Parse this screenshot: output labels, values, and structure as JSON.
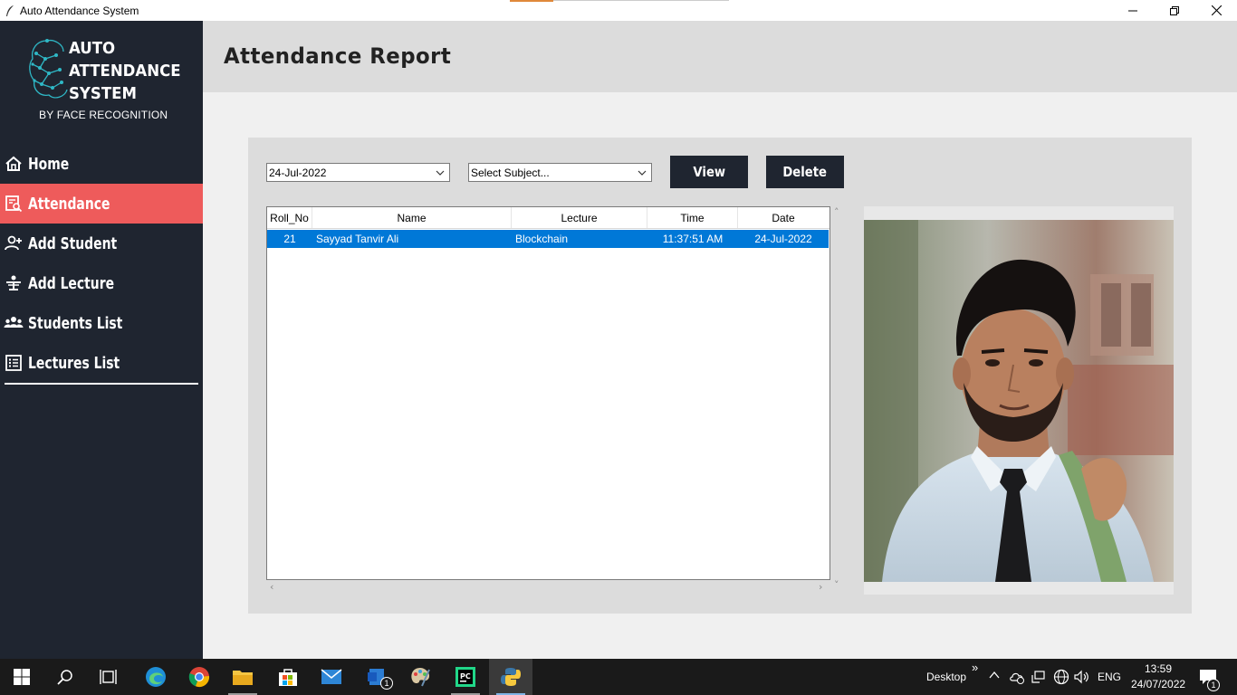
{
  "window": {
    "title": "Auto Attendance System",
    "controls": {
      "minimize": "minimize-icon",
      "maximize": "restore-icon",
      "close": "close-icon"
    }
  },
  "sidebar": {
    "logo": {
      "line1": "AUTO",
      "line2": "ATTENDANCE",
      "line3": "SYSTEM",
      "subtitle": "BY FACE RECOGNITION"
    },
    "items": [
      {
        "label": "Home",
        "icon": "home-icon",
        "active": false
      },
      {
        "label": "Attendance",
        "icon": "report-search-icon",
        "active": true
      },
      {
        "label": "Add Student",
        "icon": "add-user-icon",
        "active": false
      },
      {
        "label": "Add Lecture",
        "icon": "lecture-icon",
        "active": false
      },
      {
        "label": "Students List",
        "icon": "group-icon",
        "active": false
      },
      {
        "label": "Lectures List",
        "icon": "list-icon",
        "active": false
      }
    ],
    "colors": {
      "background": "#1f2530",
      "active": "#ee5b5b"
    }
  },
  "header": {
    "title": "Attendance Report"
  },
  "filters": {
    "date_value": "24-Jul-2022",
    "subject_value": "Select Subject...",
    "view_label": "View",
    "delete_label": "Delete"
  },
  "table": {
    "columns": [
      "Roll_No",
      "Name",
      "Lecture",
      "Time",
      "Date"
    ],
    "rows": [
      {
        "roll_no": "21",
        "name": "Sayyad Tanvir Ali",
        "lecture": "Blockchain",
        "time": "11:37:51 AM",
        "date": "24-Jul-2022",
        "selected": true
      }
    ]
  },
  "taskbar": {
    "tray": {
      "desktop_label": "Desktop",
      "overflow": "»",
      "language": "ENG",
      "time": "13:59",
      "date": "24/07/2022",
      "notification_count": "1"
    },
    "app_badge": "1"
  }
}
